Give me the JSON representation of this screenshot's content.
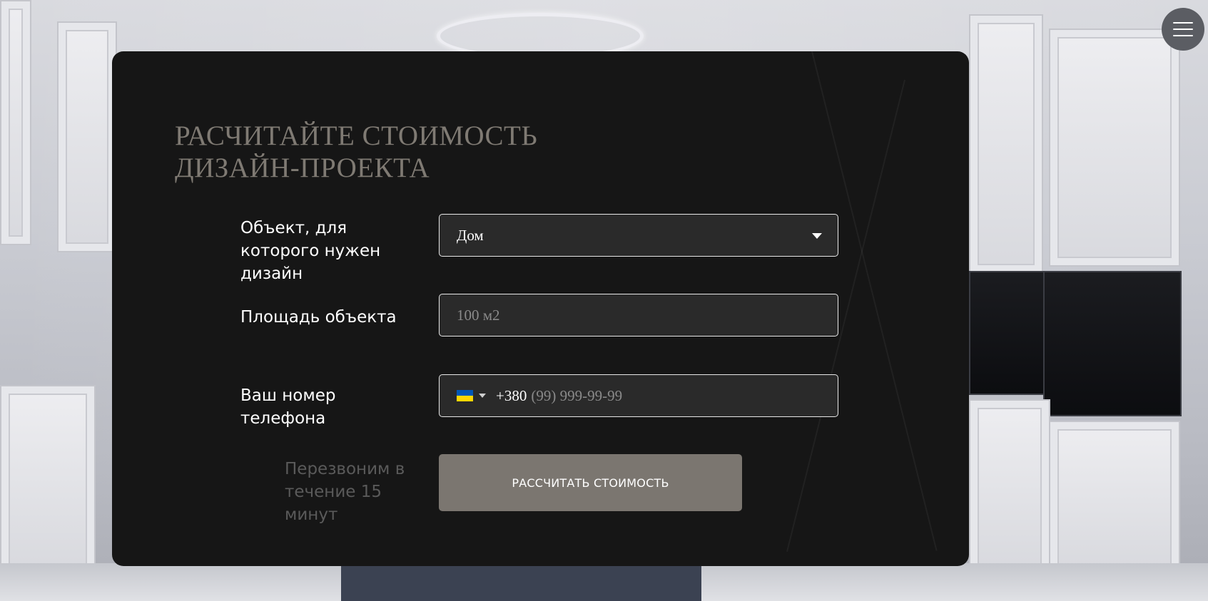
{
  "form": {
    "title_line1": "РАСЧИТАЙТЕ СТОИМОСТЬ",
    "title_line2": "ДИЗАЙН-ПРОЕКТА",
    "object_label": "Объект, для которого нужен дизайн",
    "object_value": "Дом",
    "area_label": "Площадь объекта",
    "area_placeholder": "100 м2",
    "phone_label": "Ваш номер телефона",
    "phone_code": "+380",
    "phone_placeholder": "(99) 999-99-99",
    "hint": "Перезвоним в течение 15 минут",
    "submit_label": "РАССЧИТАТЬ СТОИМОСТЬ"
  },
  "menu": {
    "icon": "hamburger-menu-icon"
  },
  "colors": {
    "card_bg": "#161616",
    "title": "#7f7a73",
    "button_bg": "#7b7670",
    "field_bg": "#2a2a2a",
    "field_border": "#e8e8e8",
    "flag_blue": "#0057b7",
    "flag_yellow": "#ffd700"
  }
}
